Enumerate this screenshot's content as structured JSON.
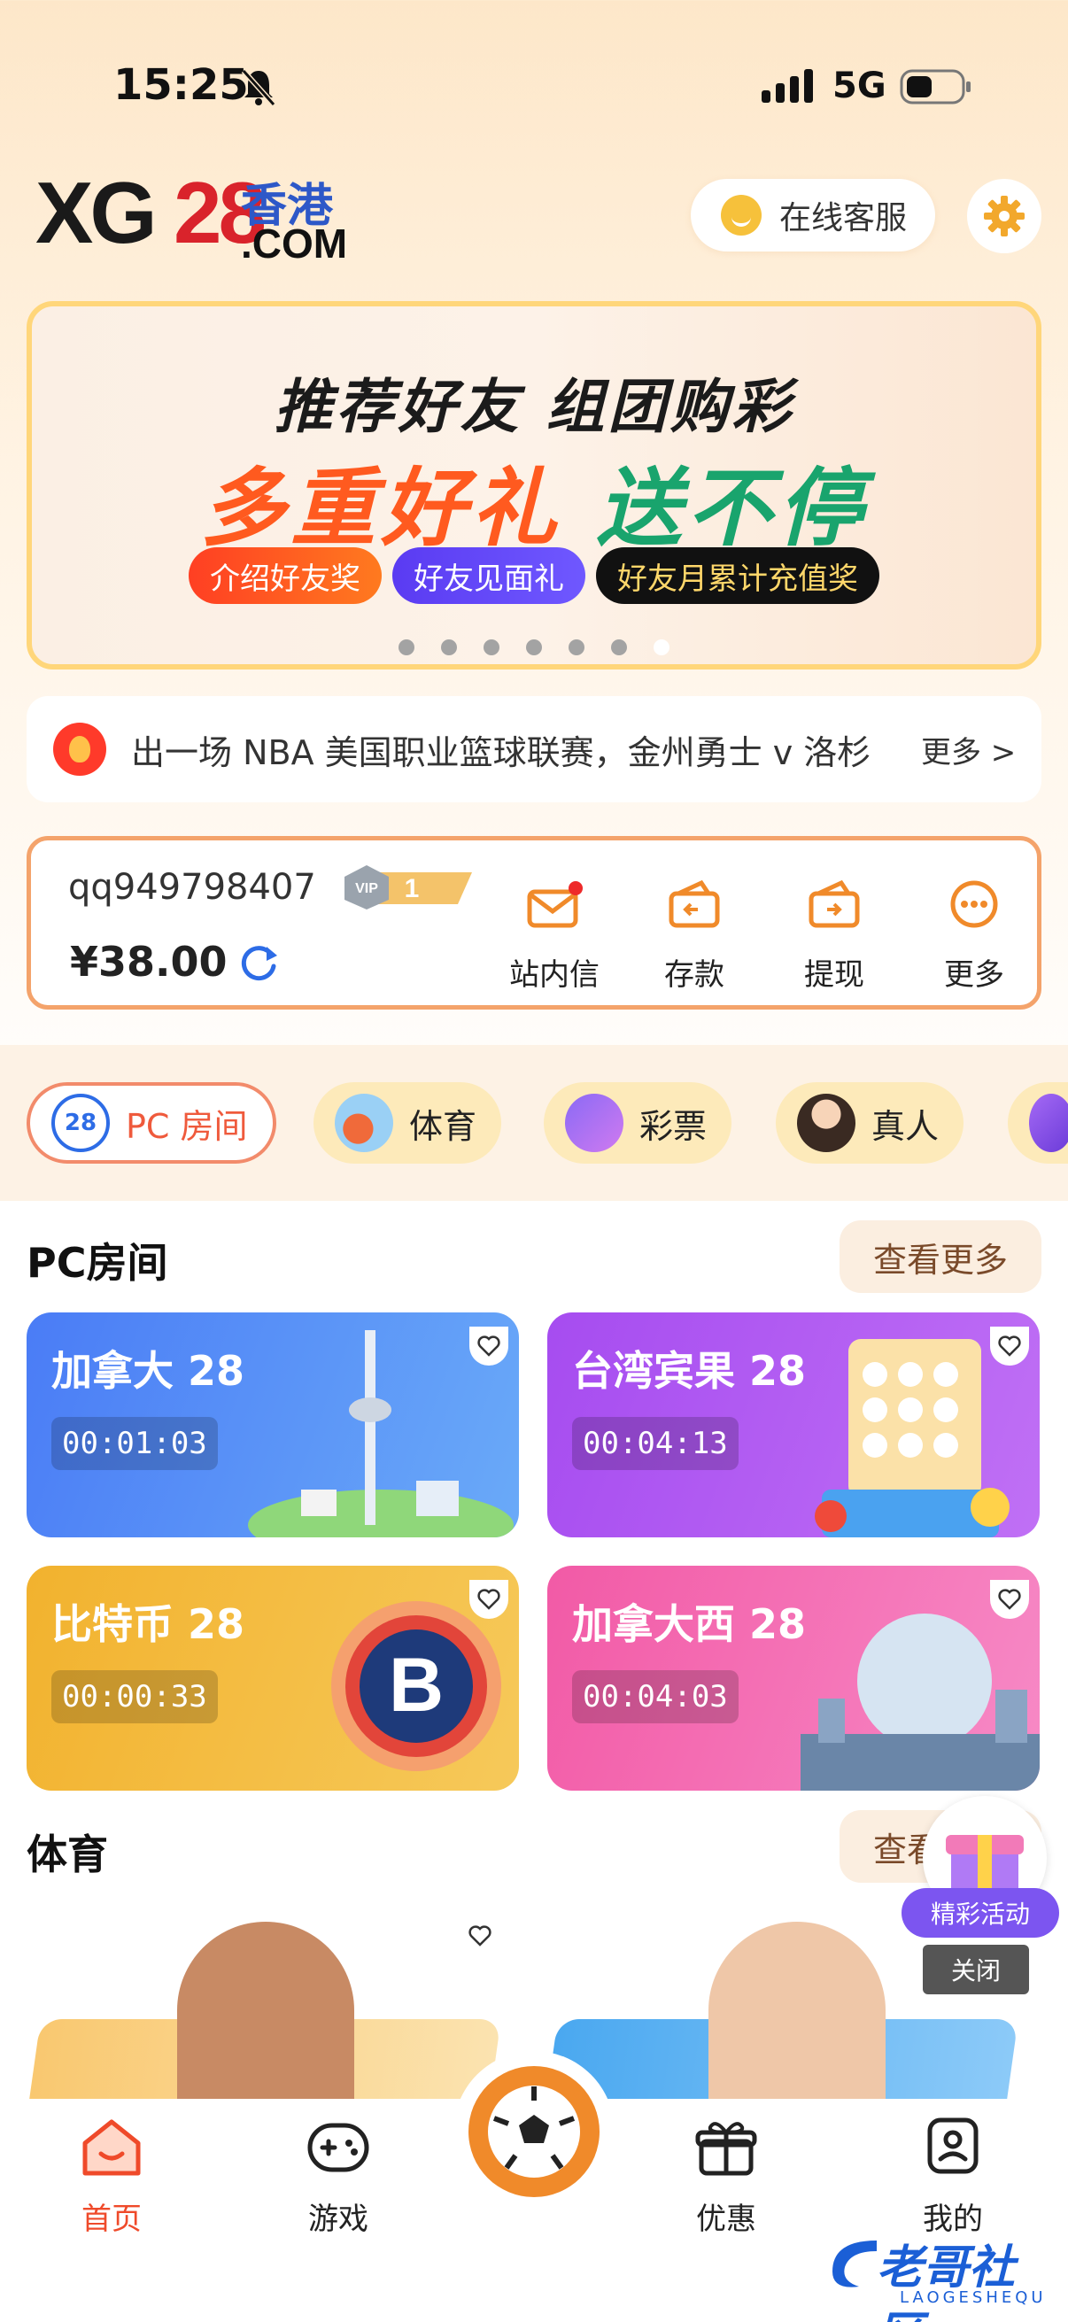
{
  "status": {
    "time": "15:25",
    "network": "5G"
  },
  "header": {
    "logo_xg": "XG",
    "logo_28": "28",
    "logo_hk": "香港",
    "logo_com": ".COM",
    "customer_service": "在线客服"
  },
  "banner": {
    "line1": "推荐好友 组团购彩",
    "line2a": "多重好礼",
    "line2b": "送不停",
    "chips": [
      "介绍好友奖",
      "好友见面礼",
      "好友月累计充值奖"
    ],
    "slide_count": 7,
    "active_slide": 7
  },
  "notice": {
    "text": "出一场 NBA 美国职业篮球联赛，金州勇士 v 洛杉",
    "more": "更多 >"
  },
  "account": {
    "username": "qq949798407",
    "vip_label": "VIP",
    "vip_level": "1",
    "balance": "¥38.00",
    "actions": [
      "站内信",
      "存款",
      "提现",
      "更多"
    ]
  },
  "categories": [
    {
      "label": "PC 房间",
      "icon": "pc28-icon",
      "active": true
    },
    {
      "label": "体育",
      "icon": "sports-icon",
      "active": false
    },
    {
      "label": "彩票",
      "icon": "lottery-icon",
      "active": false
    },
    {
      "label": "真人",
      "icon": "live-dealer-icon",
      "active": false
    }
  ],
  "pc_section": {
    "title": "PC房间",
    "more": "查看更多",
    "games": [
      {
        "name": "加拿大 28",
        "timer": "00:01:03",
        "color": "#4f7ff5"
      },
      {
        "name": "台湾宾果 28",
        "timer": "00:04:13",
        "color": "#b25cf2"
      },
      {
        "name": "比特币 28",
        "timer": "00:00:33",
        "color": "#f3b63a"
      },
      {
        "name": "加拿大西 28",
        "timer": "00:04:03",
        "color": "#f070b0"
      }
    ]
  },
  "sports_section": {
    "title": "体育",
    "more": "查看更多"
  },
  "promo": {
    "label": "精彩活动",
    "close": "关闭"
  },
  "tabbar": {
    "items": [
      "首页",
      "游戏",
      "优惠",
      "我的"
    ]
  },
  "watermark": {
    "main": "老哥社区",
    "sub": "LAOGESHEQU"
  }
}
